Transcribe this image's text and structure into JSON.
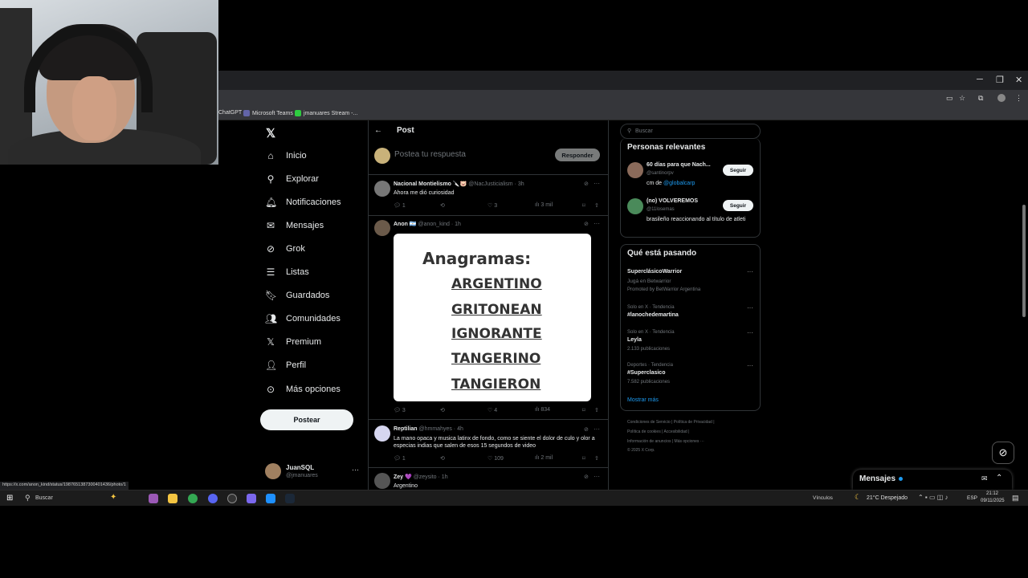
{
  "browser": {
    "bookmarks": [
      "ChatGPT",
      "Microsoft Teams",
      "jmanuares Stream -..."
    ],
    "status_url": "https://x.com/anon_kind/status/1987651387300401436/photo/1"
  },
  "nav": {
    "items": [
      "Inicio",
      "Explorar",
      "Notificaciones",
      "Mensajes",
      "Grok",
      "Listas",
      "Guardados",
      "Comunidades",
      "Premium",
      "Perfil",
      "Más opciones"
    ],
    "post_button": "Postear",
    "user_name": "JuanSQL",
    "user_handle": "@jmanuares"
  },
  "header": {
    "title": "Post"
  },
  "reply": {
    "placeholder": "Postea tu respuesta",
    "button": "Responder"
  },
  "tweets": [
    {
      "name": "Nacional Montielismo 🔪🐷",
      "handle": "@NacJusticialism · 3h",
      "text": "Ahora me dió curiosidad",
      "replies": "1",
      "likes": "3",
      "views": "3 mil"
    },
    {
      "name": "Anon 🇦🇷",
      "handle": "@anon_kind · 1h",
      "image_title": "Anagramas:",
      "image_words": [
        "ARGENTINO",
        "GRITONEAN",
        "IGNORANTE",
        "TANGERINO",
        "TANGIERON"
      ],
      "replies": "3",
      "likes": "4",
      "views": "834"
    },
    {
      "name": "Reptilian",
      "handle": "@hmmahyes · 4h",
      "text": "La mano opaca y musica latinx de fondo, como se siente el dolor de culo y olor a especias indias que salen de esos 15 segundos de video",
      "replies": "1",
      "likes": "109",
      "views": "2 mil"
    },
    {
      "name": "Zey 💜",
      "handle": "@zeysito · 1h",
      "text": "Argentino"
    }
  ],
  "search": {
    "placeholder": "Buscar"
  },
  "relevant": {
    "title": "Personas relevantes",
    "people": [
      {
        "name": "60 días para que Nach...",
        "handle": "@santinorpv",
        "bio_prefix": "cm de ",
        "bio_link": "@globalcarp",
        "button": "Seguir"
      },
      {
        "name": "(no) VOLVEREMOS",
        "handle": "@11losemas",
        "bio_prefix": "brasileño reaccionando al título de atleti",
        "bio_link": "",
        "button": "Seguir"
      }
    ]
  },
  "trends": {
    "title": "Qué está pasando",
    "items": [
      {
        "name": "SuperclásicoWarrior",
        "sub1": "Jugá en Betwarrior",
        "sub2": "Promoted by BetWarrior Argentina",
        "context": ""
      },
      {
        "context": "Solo en X · Tendencia",
        "name": "#lanochedemartina",
        "sub1": "",
        "sub2": ""
      },
      {
        "context": "Solo en X · Tendencia",
        "name": "Leyla",
        "sub1": "2.133 publicaciones",
        "sub2": ""
      },
      {
        "context": "Deportes · Tendencia",
        "name": "#Superclasico",
        "sub1": "7.582 publicaciones",
        "sub2": ""
      }
    ],
    "show_more": "Mostrar más"
  },
  "footer": {
    "line1": "Condiciones de Servicio  |  Política de Privacidad  |",
    "line2": "Política de cookies  |  Accesibilidad  |",
    "line3": "Información de anuncios  |  Más opciones ···",
    "line4": "© 2025 X Corp."
  },
  "messages_drawer": {
    "label": "Mensajes"
  },
  "taskbar": {
    "search": "Buscar",
    "links": "Vínculos",
    "weather": "21°C  Despejado",
    "lang": "ESP",
    "time": "21:12",
    "date": "09/11/2025"
  }
}
